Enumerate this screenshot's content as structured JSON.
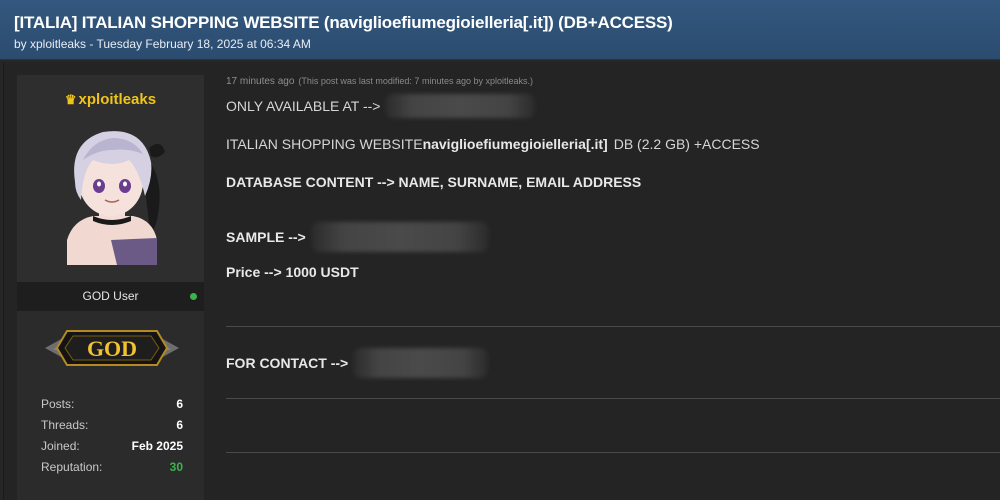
{
  "thread": {
    "title": "[ITALIA] ITALIAN SHOPPING WEBSITE (naviglioefiumegioielleria[.it]) (DB+ACCESS)",
    "meta": "by xploitleaks - Tuesday February 18, 2025 at 06:34 AM"
  },
  "author": {
    "username": "xploitleaks",
    "role": "GOD User",
    "rank_badge": "GOD",
    "online_status_color": "#3bb44a",
    "stats": [
      {
        "label": "Posts:",
        "value": "6"
      },
      {
        "label": "Threads:",
        "value": "6"
      },
      {
        "label": "Joined:",
        "value": "Feb 2025"
      },
      {
        "label": "Reputation:",
        "value": "30"
      }
    ]
  },
  "post": {
    "posted": "17 minutes ago",
    "edit_note": "(This post was last modified: 7 minutes ago by xploitleaks.)",
    "line1": "ONLY AVAILABLE AT -->",
    "line2_prefix": "ITALIAN SHOPPING WEBSITE ",
    "line2_domain": "naviglioefiumegioielleria[.it]",
    "line2_suffix": "DB (2.2 GB) +ACCESS",
    "line3": "DATABASE CONTENT --> NAME, SURNAME, EMAIL ADDRESS",
    "line4": "SAMPLE -->",
    "line5": "Price --> 1000 USDT",
    "line6": "FOR CONTACT -->"
  },
  "colors": {
    "header_blue": "#2f5277",
    "username_gold": "#f0c419",
    "reputation_green": "#3bb44a"
  },
  "icons": [
    "crown-icon",
    "online-status-icon"
  ]
}
